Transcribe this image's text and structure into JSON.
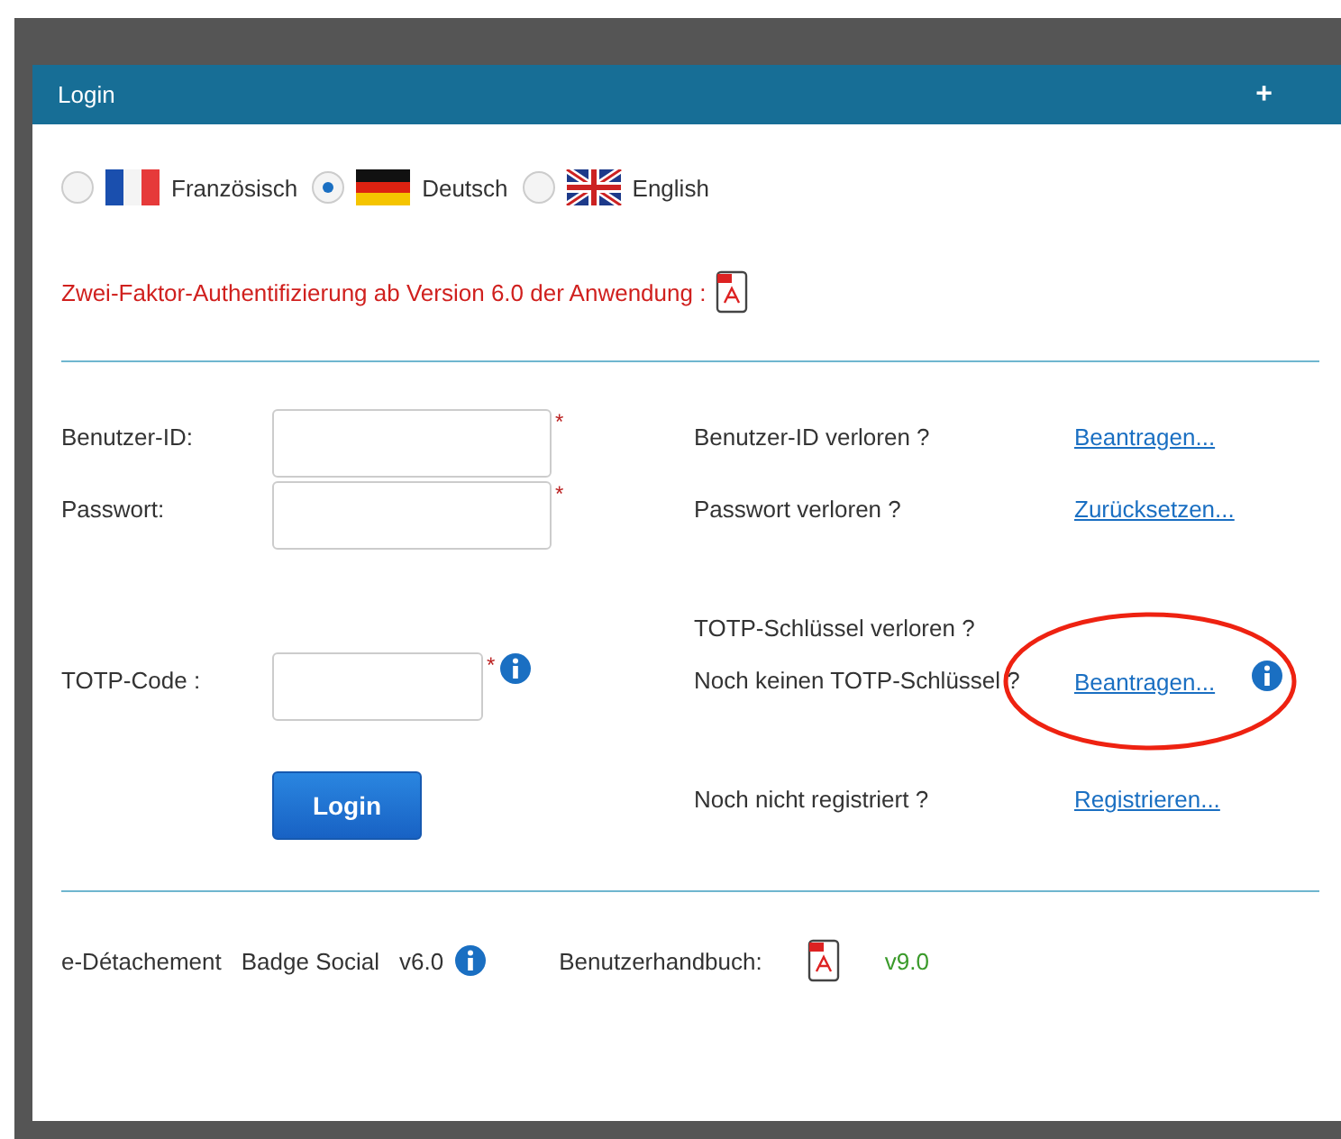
{
  "window": {
    "title": "Login",
    "action": "+"
  },
  "languages": [
    {
      "label": "Französisch",
      "kind": "fr",
      "selected": false
    },
    {
      "label": "Deutsch",
      "kind": "de",
      "selected": true
    },
    {
      "label": "English",
      "kind": "uk",
      "selected": false
    }
  ],
  "notice": "Zwei-Faktor-Authentifizierung ab Version 6.0 der Anwendung :",
  "fields": [
    {
      "label": "Benutzer-ID:",
      "required_mark": "*",
      "question": "Benutzer-ID verloren ?",
      "link": "Beantragen..."
    },
    {
      "label": "Passwort:",
      "required_mark": "*",
      "question": "Passwort verloren ?",
      "link": "Zurücksetzen..."
    },
    {
      "label": "TOTP-Code :",
      "required_mark": "*",
      "info": true,
      "question_above": "TOTP-Schlüssel verloren ?",
      "question": "Noch keinen TOTP-Schlüssel ?",
      "link": "Beantragen...",
      "link_info": true
    }
  ],
  "login_button": "Login",
  "register": {
    "question": "Noch nicht registriert ?",
    "link": "Registrieren..."
  },
  "footer": {
    "app": "e-Détachement",
    "product": "Badge Social",
    "version": "v6.0",
    "manual_label": "Benutzerhandbuch:",
    "manual_version": "v9.0"
  }
}
